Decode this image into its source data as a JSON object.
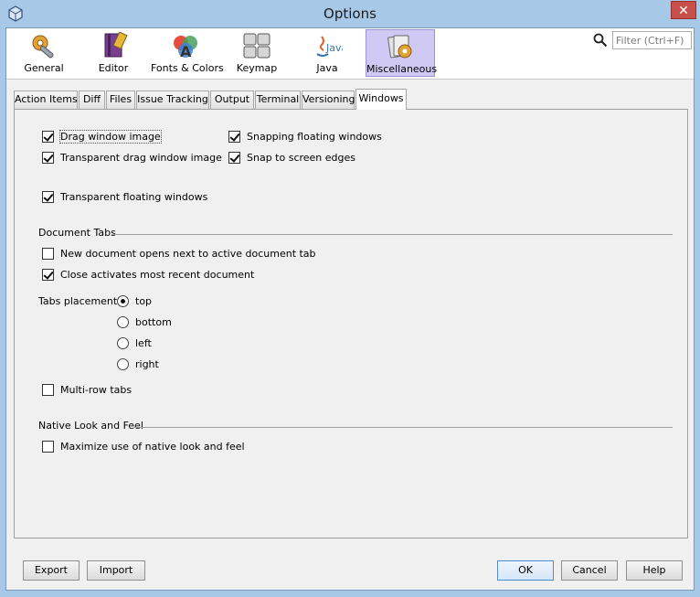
{
  "window": {
    "title": "Options",
    "close_glyph": "✕"
  },
  "categories": [
    {
      "label": "General",
      "icon": "general-icon"
    },
    {
      "label": "Editor",
      "icon": "editor-icon"
    },
    {
      "label": "Fonts & Colors",
      "icon": "fonts-colors-icon"
    },
    {
      "label": "Keymap",
      "icon": "keymap-icon"
    },
    {
      "label": "Java",
      "icon": "java-icon"
    },
    {
      "label": "Miscellaneous",
      "icon": "miscellaneous-icon",
      "selected": true
    }
  ],
  "search": {
    "placeholder": "Filter (Ctrl+F)",
    "value": ""
  },
  "tabs": [
    {
      "label": "Action Items"
    },
    {
      "label": "Diff"
    },
    {
      "label": "Files"
    },
    {
      "label": "Issue Tracking"
    },
    {
      "label": "Output"
    },
    {
      "label": "Terminal"
    },
    {
      "label": "Versioning"
    },
    {
      "label": "Windows",
      "active": true
    }
  ],
  "windows": {
    "drag_window_image": {
      "label": "Drag window image",
      "checked": true
    },
    "transparent_drag_window_image": {
      "label": "Transparent drag window image",
      "checked": true
    },
    "snapping_floating_windows": {
      "label": "Snapping floating windows",
      "checked": true
    },
    "snap_to_screen_edges": {
      "label": "Snap to screen edges",
      "checked": true
    },
    "transparent_floating_windows": {
      "label": "Transparent floating windows",
      "checked": true
    }
  },
  "document_tabs": {
    "heading": "Document Tabs",
    "new_document_next": {
      "label": "New document opens next to active document tab",
      "checked": false
    },
    "close_activates_recent": {
      "label": "Close activates most recent document",
      "checked": true
    },
    "placement_label": "Tabs placement:",
    "placement_options": [
      "top",
      "bottom",
      "left",
      "right"
    ],
    "placement_selected": "top",
    "multi_row": {
      "label": "Multi-row tabs",
      "checked": false
    }
  },
  "native_laf": {
    "heading": "Native Look and Feel",
    "maximize_native": {
      "label": "Maximize use of native look and feel",
      "checked": false
    }
  },
  "buttons": {
    "export": "Export",
    "import": "Import",
    "ok": "OK",
    "cancel": "Cancel",
    "help": "Help"
  },
  "colors": {
    "titlebar": "#a8c8e8",
    "selected_category": "#cfc9f3",
    "close_button": "#c7504b"
  }
}
